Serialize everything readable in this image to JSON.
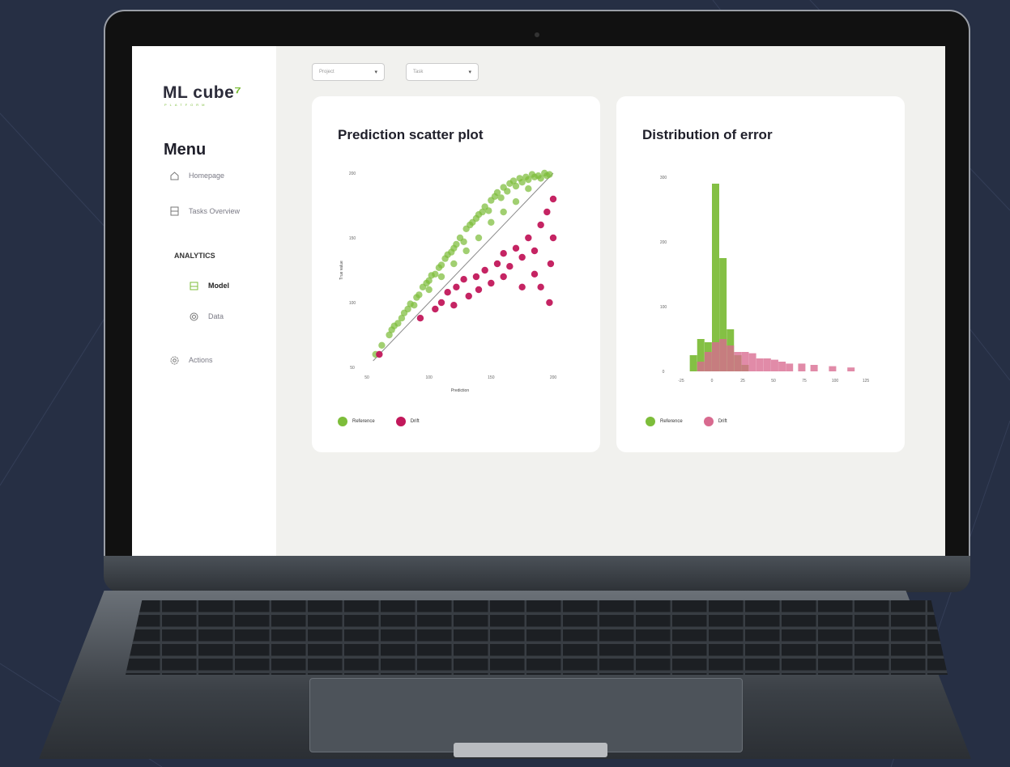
{
  "colors": {
    "accent": "#7dbd3a",
    "reference": "#7dbd3a",
    "drift_scatter": "#c2185b",
    "drift_hist": "#d86a8f"
  },
  "app": {
    "logo": "ML cube",
    "logo_sub": "PLATFORM",
    "menu_title": "Menu",
    "nav": [
      {
        "label": "Homepage",
        "icon": "home-icon"
      },
      {
        "label": "Tasks Overview",
        "icon": "list-icon"
      }
    ],
    "section": "ANALYTICS",
    "analytics_items": [
      {
        "label": "Model",
        "icon": "model-icon",
        "active": true
      },
      {
        "label": "Data",
        "icon": "data-icon",
        "active": false
      }
    ],
    "actions": {
      "label": "Actions",
      "icon": "gear-icon"
    },
    "filters": [
      {
        "value": "Project",
        "icon": "chevron-down-icon"
      },
      {
        "value": "Task",
        "icon": "chevron-down-icon"
      }
    ]
  },
  "chart_data": [
    {
      "type": "scatter",
      "title": "Prediction scatter plot",
      "xlabel": "Prediction",
      "ylabel": "True value",
      "xlim": [
        50,
        200
      ],
      "ylim": [
        50,
        200
      ],
      "xticks": [
        "50",
        "100",
        "150",
        "200"
      ],
      "yticks": [
        "50",
        "100",
        "150",
        "200"
      ],
      "series": [
        {
          "name": "Reference",
          "color": "#7dbd3a",
          "points": [
            [
              57,
              60
            ],
            [
              62,
              67
            ],
            [
              68,
              75
            ],
            [
              70,
              79
            ],
            [
              72,
              82
            ],
            [
              75,
              84
            ],
            [
              78,
              88
            ],
            [
              80,
              92
            ],
            [
              83,
              95
            ],
            [
              85,
              99
            ],
            [
              88,
              98
            ],
            [
              90,
              104
            ],
            [
              92,
              106
            ],
            [
              95,
              112
            ],
            [
              98,
              115
            ],
            [
              100,
              117
            ],
            [
              102,
              121
            ],
            [
              105,
              122
            ],
            [
              108,
              127
            ],
            [
              110,
              129
            ],
            [
              113,
              134
            ],
            [
              115,
              137
            ],
            [
              118,
              139
            ],
            [
              120,
              142
            ],
            [
              122,
              145
            ],
            [
              125,
              150
            ],
            [
              128,
              147
            ],
            [
              130,
              157
            ],
            [
              133,
              160
            ],
            [
              135,
              162
            ],
            [
              138,
              165
            ],
            [
              140,
              168
            ],
            [
              143,
              170
            ],
            [
              145,
              174
            ],
            [
              148,
              171
            ],
            [
              150,
              179
            ],
            [
              153,
              182
            ],
            [
              155,
              185
            ],
            [
              158,
              181
            ],
            [
              160,
              189
            ],
            [
              163,
              186
            ],
            [
              165,
              192
            ],
            [
              168,
              194
            ],
            [
              170,
              190
            ],
            [
              173,
              196
            ],
            [
              175,
              193
            ],
            [
              178,
              197
            ],
            [
              180,
              195
            ],
            [
              183,
              199
            ],
            [
              185,
              197
            ],
            [
              188,
              198
            ],
            [
              190,
              196
            ],
            [
              193,
              200
            ],
            [
              195,
              198
            ],
            [
              197,
              199
            ],
            [
              140,
              150
            ],
            [
              150,
              162
            ],
            [
              160,
              170
            ],
            [
              120,
              130
            ],
            [
              100,
              110
            ],
            [
              130,
              140
            ],
            [
              170,
              178
            ],
            [
              180,
              188
            ],
            [
              110,
              120
            ]
          ]
        },
        {
          "name": "Drift",
          "color": "#c2185b",
          "points": [
            [
              60,
              60
            ],
            [
              93,
              88
            ],
            [
              105,
              95
            ],
            [
              110,
              100
            ],
            [
              115,
              108
            ],
            [
              122,
              112
            ],
            [
              128,
              118
            ],
            [
              132,
              105
            ],
            [
              138,
              120
            ],
            [
              145,
              125
            ],
            [
              150,
              115
            ],
            [
              155,
              130
            ],
            [
              160,
              138
            ],
            [
              165,
              128
            ],
            [
              170,
              142
            ],
            [
              175,
              135
            ],
            [
              180,
              150
            ],
            [
              185,
              140
            ],
            [
              190,
              160
            ],
            [
              195,
              170
            ],
            [
              197,
              100
            ],
            [
              198,
              130
            ],
            [
              200,
              150
            ],
            [
              120,
              98
            ],
            [
              140,
              110
            ],
            [
              160,
              120
            ],
            [
              175,
              112
            ],
            [
              185,
              122
            ],
            [
              190,
              112
            ],
            [
              200,
              180
            ]
          ]
        }
      ],
      "legend": [
        "Reference",
        "Drift"
      ],
      "legend_position": "bottom-left",
      "reference_line": true
    },
    {
      "type": "bar",
      "title": "Distribution of error",
      "xlabel": "",
      "ylabel": "",
      "xlim": [
        -25,
        125
      ],
      "ylim": [
        0,
        300
      ],
      "xticks": [
        "-25",
        "0",
        "25",
        "50",
        "75",
        "100",
        "125"
      ],
      "yticks": [
        "0",
        "100",
        "200",
        "300"
      ],
      "bin_width": 6.25,
      "series": [
        {
          "name": "Reference",
          "color": "#7dbd3a",
          "bins": [
            [
              -18,
              25
            ],
            [
              -12,
              50
            ],
            [
              -6,
              45
            ],
            [
              0,
              290
            ],
            [
              6,
              175
            ],
            [
              12,
              65
            ],
            [
              18,
              25
            ],
            [
              24,
              10
            ]
          ]
        },
        {
          "name": "Drift",
          "color": "#d86a8f",
          "bins": [
            [
              -12,
              15
            ],
            [
              -6,
              30
            ],
            [
              0,
              45
            ],
            [
              6,
              50
            ],
            [
              12,
              40
            ],
            [
              18,
              30
            ],
            [
              24,
              30
            ],
            [
              30,
              28
            ],
            [
              36,
              20
            ],
            [
              42,
              20
            ],
            [
              48,
              18
            ],
            [
              54,
              15
            ],
            [
              60,
              12
            ],
            [
              70,
              12
            ],
            [
              80,
              10
            ],
            [
              95,
              8
            ],
            [
              110,
              6
            ]
          ]
        }
      ],
      "legend": [
        "Reference",
        "Drift"
      ],
      "legend_position": "bottom-left"
    }
  ]
}
